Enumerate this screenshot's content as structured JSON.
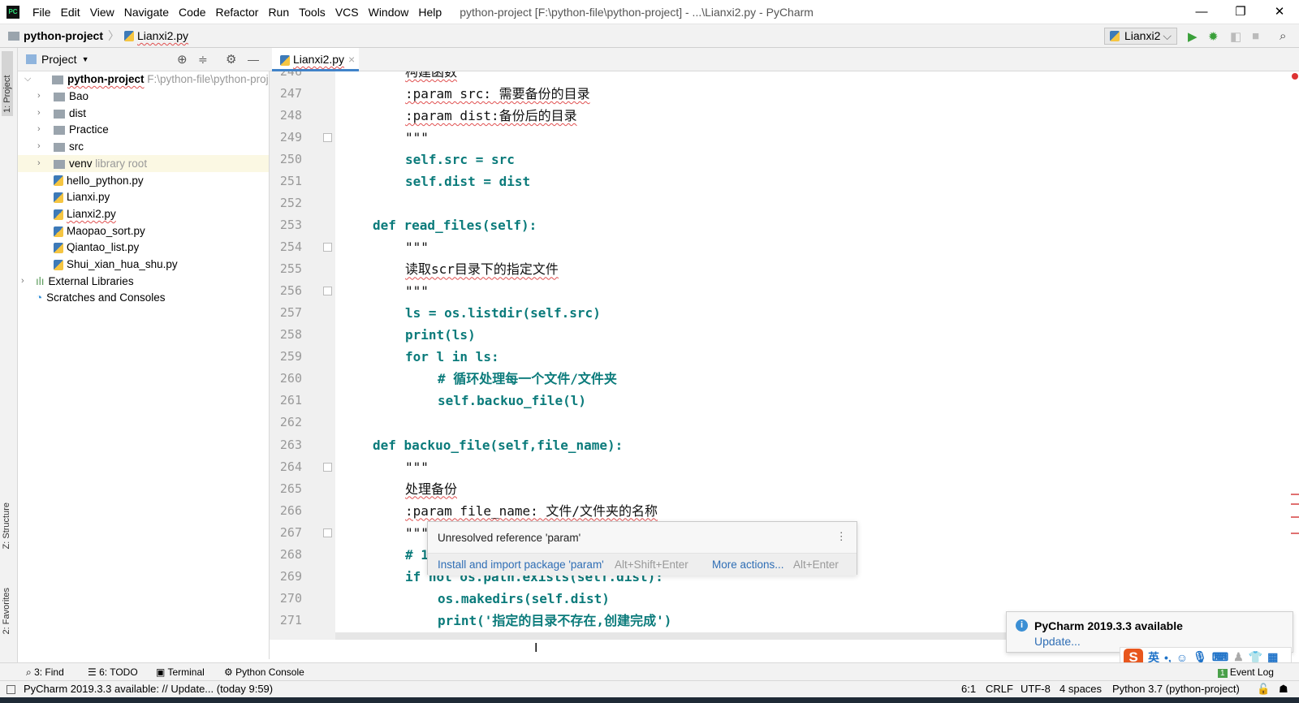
{
  "menubar": {
    "items": [
      "File",
      "Edit",
      "View",
      "Navigate",
      "Code",
      "Refactor",
      "Run",
      "Tools",
      "VCS",
      "Window",
      "Help"
    ],
    "title": "python-project [F:\\python-file\\python-project] - ...\\Lianxi2.py - PyCharm"
  },
  "navbar": {
    "project": "python-project",
    "file": "Lianxi2.py",
    "run_config": "Lianxi2"
  },
  "left_stripe": {
    "project": "1: Project",
    "structure": "Z: Structure",
    "favorites": "2: Favorites"
  },
  "project_panel": {
    "title": "Project",
    "root": {
      "name": "python-project",
      "path": "F:\\python-file\\python-project"
    },
    "items": [
      {
        "name": "Bao",
        "type": "folder",
        "expandable": true
      },
      {
        "name": "dist",
        "type": "folder",
        "expandable": true
      },
      {
        "name": "Practice",
        "type": "folder",
        "expandable": true
      },
      {
        "name": "src",
        "type": "folder",
        "expandable": true
      },
      {
        "name": "venv",
        "type": "folder",
        "expandable": true,
        "hint": "library root"
      },
      {
        "name": "hello_python.py",
        "type": "py"
      },
      {
        "name": "Lianxi.py",
        "type": "py"
      },
      {
        "name": "Lianxi2.py",
        "type": "py"
      },
      {
        "name": "Maopao_sort.py",
        "type": "py"
      },
      {
        "name": "Qiantao_list.py",
        "type": "py"
      },
      {
        "name": "Shui_xian_hua_shu.py",
        "type": "py"
      }
    ],
    "external": "External Libraries",
    "scratches": "Scratches and Consoles"
  },
  "editor": {
    "tab": "Lianxi2.py",
    "lines": [
      {
        "n": "246",
        "indent": 8,
        "style": "doc",
        "text": "构建函数"
      },
      {
        "n": "247",
        "indent": 8,
        "style": "doc",
        "text": ":param src: 需要备份的目录"
      },
      {
        "n": "248",
        "indent": 8,
        "style": "doc",
        "text": ":param dist:备份后的目录"
      },
      {
        "n": "249",
        "indent": 8,
        "style": "doc",
        "text": "\"\"\""
      },
      {
        "n": "250",
        "indent": 8,
        "style": "code",
        "text": "self.src = src"
      },
      {
        "n": "251",
        "indent": 8,
        "style": "code",
        "text": "self.dist = dist"
      },
      {
        "n": "252",
        "indent": 0,
        "style": "code",
        "text": ""
      },
      {
        "n": "253",
        "indent": 4,
        "style": "code",
        "text": "def read_files(self):"
      },
      {
        "n": "254",
        "indent": 8,
        "style": "doc",
        "text": "\"\"\""
      },
      {
        "n": "255",
        "indent": 8,
        "style": "doc",
        "text": "读取scr目录下的指定文件"
      },
      {
        "n": "256",
        "indent": 8,
        "style": "doc",
        "text": "\"\"\""
      },
      {
        "n": "257",
        "indent": 8,
        "style": "code",
        "text": "ls = os.listdir(self.src)"
      },
      {
        "n": "258",
        "indent": 8,
        "style": "code",
        "text": "print(ls)"
      },
      {
        "n": "259",
        "indent": 8,
        "style": "code",
        "text": "for l in ls:"
      },
      {
        "n": "260",
        "indent": 12,
        "style": "code",
        "text": "# 循环处理每一个文件/文件夹"
      },
      {
        "n": "261",
        "indent": 12,
        "style": "code",
        "text": "self.backuo_file(l)"
      },
      {
        "n": "262",
        "indent": 0,
        "style": "code",
        "text": ""
      },
      {
        "n": "263",
        "indent": 4,
        "style": "code",
        "text": "def backuo_file(self,file_name):"
      },
      {
        "n": "264",
        "indent": 8,
        "style": "doc",
        "text": "\"\"\""
      },
      {
        "n": "265",
        "indent": 8,
        "style": "doc",
        "text": "处理备份"
      },
      {
        "n": "266",
        "indent": 8,
        "style": "doc",
        "text": ":param file_name: 文件/文件夹的名称"
      },
      {
        "n": "267",
        "indent": 8,
        "style": "doc",
        "text": "\"\"\""
      },
      {
        "n": "268",
        "indent": 8,
        "style": "code",
        "text": "# 1"
      },
      {
        "n": "269",
        "indent": 8,
        "style": "code",
        "text": "if not os.path.exists(self.dist):"
      },
      {
        "n": "270",
        "indent": 12,
        "style": "code",
        "text": "os.makedirs(self.dist)"
      },
      {
        "n": "271",
        "indent": 12,
        "style": "code",
        "text": "print('指定的目录不存在,创建完成')"
      }
    ]
  },
  "popup": {
    "message": "Unresolved reference 'param'",
    "action": "Install and import package 'param'",
    "action_shortcut": "Alt+Shift+Enter",
    "more": "More actions...",
    "more_shortcut": "Alt+Enter"
  },
  "notification": {
    "title": "PyCharm 2019.3.3 available",
    "link": "Update..."
  },
  "ime": {
    "lang": "英"
  },
  "tool_windows": {
    "find": "3: Find",
    "todo": "6: TODO",
    "terminal": "Terminal",
    "console": "Python Console",
    "event_log": "Event Log",
    "event_count": "1"
  },
  "status": {
    "message": "PyCharm 2019.3.3 available: // Update... (today 9:59)",
    "position": "6:1",
    "line_sep": "CRLF",
    "encoding": "UTF-8",
    "indent": "4 spaces",
    "interpreter": "Python 3.7 (python-project)"
  },
  "colors": {
    "accent": "#4083c9",
    "code": "#0b7b7b",
    "run": "#3aa03a",
    "link": "#2f6eb5"
  }
}
